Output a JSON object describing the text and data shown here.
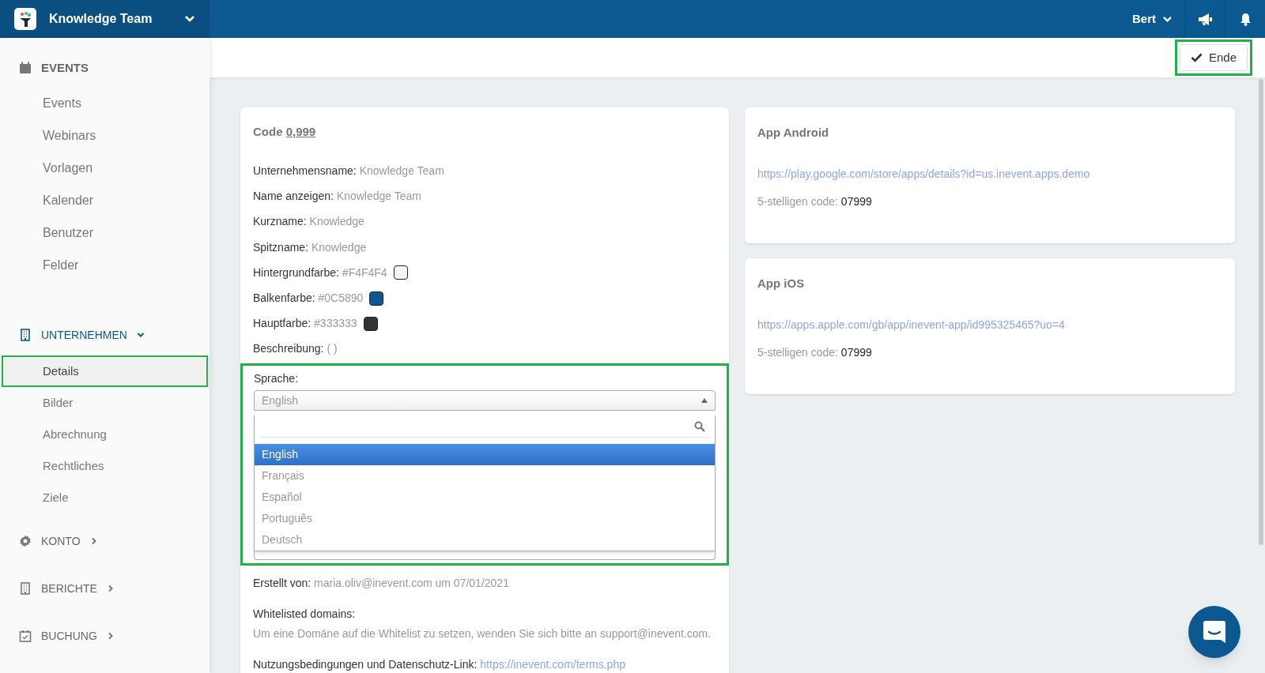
{
  "topbar": {
    "org": "Knowledge Team",
    "user": "Bert"
  },
  "toolbar": {
    "done_button": "Ende",
    "highlighted": true
  },
  "sidebar": {
    "sections": [
      {
        "label": "EVENTS",
        "kind": "fixed",
        "active": false,
        "items": [
          {
            "label": "Events",
            "selected": false,
            "highlighted": false
          },
          {
            "label": "Webinars",
            "selected": false,
            "highlighted": false
          },
          {
            "label": "Vorlagen",
            "selected": false,
            "highlighted": false
          },
          {
            "label": "Kalender",
            "selected": false,
            "highlighted": false
          },
          {
            "label": "Benutzer",
            "selected": false,
            "highlighted": false
          },
          {
            "label": "Felder",
            "selected": false,
            "highlighted": false
          }
        ]
      },
      {
        "label": "UNTERNEHMEN",
        "kind": "collapsible",
        "expanded": true,
        "active": true,
        "items": [
          {
            "label": "Details",
            "selected": true,
            "highlighted": true
          },
          {
            "label": "Bilder",
            "selected": false,
            "highlighted": false
          },
          {
            "label": "Abrechnung",
            "selected": false,
            "highlighted": false
          },
          {
            "label": "Rechtliches",
            "selected": false,
            "highlighted": false
          },
          {
            "label": "Ziele",
            "selected": false,
            "highlighted": false
          }
        ]
      },
      {
        "label": "KONTO",
        "kind": "collapsible",
        "expanded": false,
        "active": false
      },
      {
        "label": "BERICHTE",
        "kind": "collapsible",
        "expanded": false,
        "active": false
      },
      {
        "label": "BUCHUNG",
        "kind": "collapsible",
        "expanded": false,
        "active": false
      }
    ]
  },
  "details": {
    "code_label": "Code",
    "code": "0,999",
    "fields": [
      {
        "label": "Unternehmensname:",
        "value": "Knowledge Team"
      },
      {
        "label": "Name anzeigen:",
        "value": "Knowledge Team"
      },
      {
        "label": "Kurzname:",
        "value": "Knowledge"
      },
      {
        "label": "Spitzname:",
        "value": "Knowledge"
      },
      {
        "label": "Hintergrundfarbe:",
        "value": "#F4F4F4",
        "color": "#f4f4f4"
      },
      {
        "label": "Balkenfarbe:",
        "value": "#0C5890",
        "color": "#0c5890"
      },
      {
        "label": "Hauptfarbe:",
        "value": "#333333",
        "color": "#333333"
      },
      {
        "label": "Beschreibung:",
        "value": "( )"
      }
    ],
    "language": {
      "label": "Sprache:",
      "value": "English",
      "open": true,
      "highlighted": true,
      "options": [
        {
          "label": "English",
          "selected": true
        },
        {
          "label": "Français",
          "selected": false
        },
        {
          "label": "Español",
          "selected": false
        },
        {
          "label": "Português",
          "selected": false
        },
        {
          "label": "Deutsch",
          "selected": false
        }
      ]
    },
    "created": {
      "label": "Erstellt von:",
      "value": "maria.oliv@inevent.com um 07/01/2021"
    },
    "whitelist": {
      "label": "Whitelisted domains:",
      "note": "Um eine Domäne auf die Whitelist zu setzen, wenden Sie sich bitte an support@inevent.com."
    },
    "terms": {
      "label": "Nutzungsbedingungen und Datenschutz-Link:",
      "link": "https://inevent.com/terms.php"
    }
  },
  "apps": [
    {
      "title": "App Android",
      "link": "https://play.google.com/store/apps/details?id=us.inevent.apps.demo",
      "code_label": "5-stelligen code:",
      "code": "07999"
    },
    {
      "title": "App iOS",
      "link": "https://apps.apple.com/gb/app/inevent-app/id995325465?uo=4",
      "code_label": "5-stelligen code:",
      "code": "07999"
    }
  ]
}
